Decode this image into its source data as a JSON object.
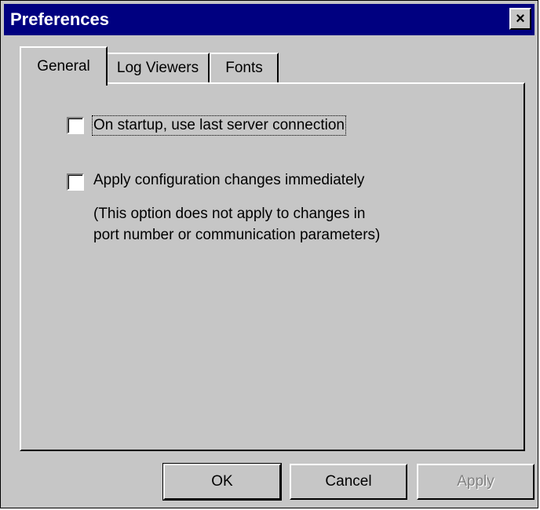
{
  "window": {
    "title": "Preferences",
    "close_glyph": "×",
    "colors": {
      "titlebar": "#000080",
      "face": "#c6c6c6",
      "disabled_text": "#808080"
    }
  },
  "tabs": [
    {
      "label": "General",
      "active": true
    },
    {
      "label": "Log Viewers",
      "active": false
    },
    {
      "label": "Fonts",
      "active": false
    }
  ],
  "general": {
    "options": [
      {
        "label": "On startup, use last server connection",
        "checked": false
      },
      {
        "label": "Apply configuration changes immediately",
        "checked": false
      }
    ],
    "note_lines": [
      "(This option does not apply to changes in",
      "port number or communication parameters)"
    ]
  },
  "buttons": {
    "ok": "OK",
    "cancel": "Cancel",
    "apply": "Apply"
  }
}
